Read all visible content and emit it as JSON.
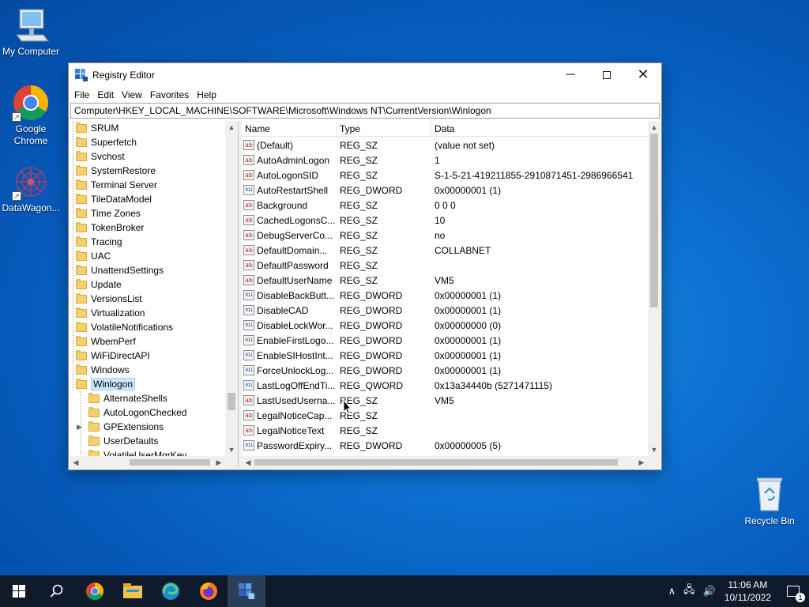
{
  "desktop": {
    "icons": [
      {
        "label": "My Computer"
      },
      {
        "label": "Google Chrome"
      },
      {
        "label": "DataWagon..."
      },
      {
        "label": "Recycle Bin"
      }
    ]
  },
  "window": {
    "title": "Registry Editor",
    "menu": [
      "File",
      "Edit",
      "View",
      "Favorites",
      "Help"
    ],
    "address": "Computer\\HKEY_LOCAL_MACHINE\\SOFTWARE\\Microsoft\\Windows NT\\CurrentVersion\\Winlogon"
  },
  "tree": {
    "items": [
      "SRUM",
      "Superfetch",
      "Svchost",
      "SystemRestore",
      "Terminal Server",
      "TileDataModel",
      "Time Zones",
      "TokenBroker",
      "Tracing",
      "UAC",
      "UnattendSettings",
      "Update",
      "VersionsList",
      "Virtualization",
      "VolatileNotifications",
      "WbemPerf",
      "WiFiDirectAPI",
      "Windows",
      "Winlogon"
    ],
    "selected": "Winlogon",
    "children": [
      "AlternateShells",
      "AutoLogonChecked",
      "GPExtensions",
      "UserDefaults",
      "VolatileUserMgrKey"
    ]
  },
  "list": {
    "headers": {
      "name": "Name",
      "type": "Type",
      "data": "Data"
    },
    "rows": [
      {
        "name": "(Default)",
        "type": "REG_SZ",
        "data": "(value not set)"
      },
      {
        "name": "AutoAdminLogon",
        "type": "REG_SZ",
        "data": "1"
      },
      {
        "name": "AutoLogonSID",
        "type": "REG_SZ",
        "data": "S-1-5-21-419211855-2910871451-2986966541"
      },
      {
        "name": "AutoRestartShell",
        "type": "REG_DWORD",
        "data": "0x00000001 (1)"
      },
      {
        "name": "Background",
        "type": "REG_SZ",
        "data": "0 0 0"
      },
      {
        "name": "CachedLogonsC...",
        "type": "REG_SZ",
        "data": "10"
      },
      {
        "name": "DebugServerCo...",
        "type": "REG_SZ",
        "data": "no"
      },
      {
        "name": "DefaultDomain...",
        "type": "REG_SZ",
        "data": "COLLABNET"
      },
      {
        "name": "DefaultPassword",
        "type": "REG_SZ",
        "data": ""
      },
      {
        "name": "DefaultUserName",
        "type": "REG_SZ",
        "data": "VM5"
      },
      {
        "name": "DisableBackButt...",
        "type": "REG_DWORD",
        "data": "0x00000001 (1)"
      },
      {
        "name": "DisableCAD",
        "type": "REG_DWORD",
        "data": "0x00000001 (1)"
      },
      {
        "name": "DisableLockWor...",
        "type": "REG_DWORD",
        "data": "0x00000000 (0)"
      },
      {
        "name": "EnableFirstLogo...",
        "type": "REG_DWORD",
        "data": "0x00000001 (1)"
      },
      {
        "name": "EnableSIHostInt...",
        "type": "REG_DWORD",
        "data": "0x00000001 (1)"
      },
      {
        "name": "ForceUnlockLog...",
        "type": "REG_DWORD",
        "data": "0x00000001 (1)"
      },
      {
        "name": "LastLogOffEndTi...",
        "type": "REG_QWORD",
        "data": "0x13a34440b (5271471115)"
      },
      {
        "name": "LastUsedUserna...",
        "type": "REG_SZ",
        "data": "VM5"
      },
      {
        "name": "LegalNoticeCap...",
        "type": "REG_SZ",
        "data": ""
      },
      {
        "name": "LegalNoticeText",
        "type": "REG_SZ",
        "data": ""
      },
      {
        "name": "PasswordExpiry...",
        "type": "REG_DWORD",
        "data": "0x00000005 (5)"
      }
    ]
  },
  "taskbar": {
    "time": "11:06 AM",
    "date": "10/11/2022",
    "notifications": "1"
  },
  "colors": {
    "accent": "#0078d7",
    "selection": "#cce8ff",
    "taskbar": "#0f1a2b"
  }
}
